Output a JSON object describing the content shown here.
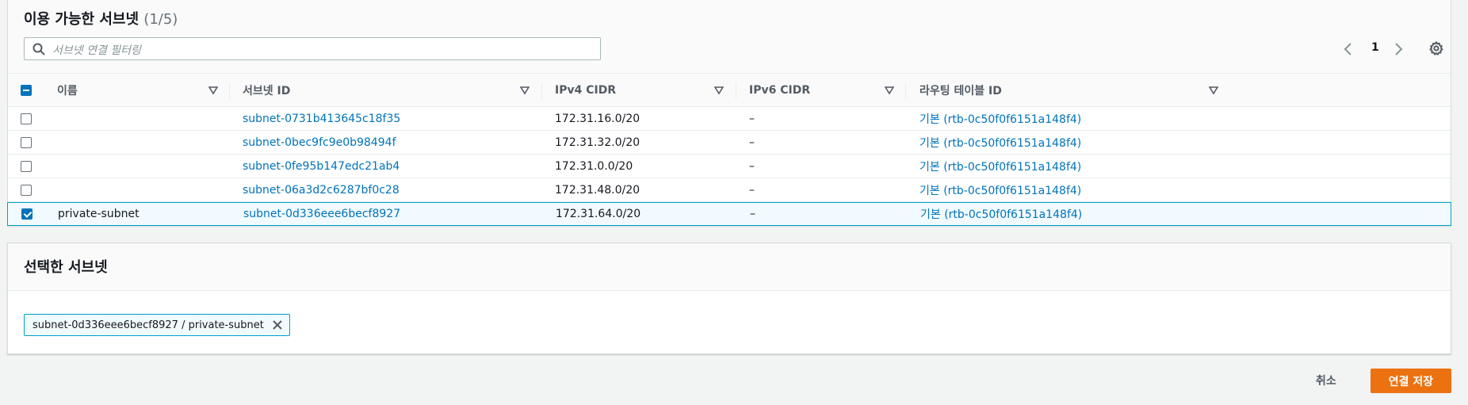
{
  "panel": {
    "title": "이용 가능한 서브넷",
    "count": "(1/5)",
    "filter_placeholder": "서브넷 연결 필터링",
    "page": "1"
  },
  "table": {
    "columns": [
      "이름",
      "서브넷 ID",
      "IPv4 CIDR",
      "IPv6 CIDR",
      "라우팅 테이블 ID"
    ],
    "rows": [
      {
        "name": "",
        "subnet_id": "subnet-0731b413645c18f35",
        "ipv4": "172.31.16.0/20",
        "ipv6": "–",
        "route_table": "기본 (rtb-0c50f0f6151a148f4)",
        "checked": false
      },
      {
        "name": "",
        "subnet_id": "subnet-0bec9fc9e0b98494f",
        "ipv4": "172.31.32.0/20",
        "ipv6": "–",
        "route_table": "기본 (rtb-0c50f0f6151a148f4)",
        "checked": false
      },
      {
        "name": "",
        "subnet_id": "subnet-0fe95b147edc21ab4",
        "ipv4": "172.31.0.0/20",
        "ipv6": "–",
        "route_table": "기본 (rtb-0c50f0f6151a148f4)",
        "checked": false
      },
      {
        "name": "",
        "subnet_id": "subnet-06a3d2c6287bf0c28",
        "ipv4": "172.31.48.0/20",
        "ipv6": "–",
        "route_table": "기본 (rtb-0c50f0f6151a148f4)",
        "checked": false
      },
      {
        "name": "private-subnet",
        "subnet_id": "subnet-0d336eee6becf8927",
        "ipv4": "172.31.64.0/20",
        "ipv6": "–",
        "route_table": "기본 (rtb-0c50f0f6151a148f4)",
        "checked": true
      }
    ]
  },
  "selected": {
    "title": "선택한 서브넷",
    "token": "subnet-0d336eee6becf8927 / private-subnet"
  },
  "actions": {
    "cancel": "취소",
    "save": "연결 저장"
  },
  "colors": {
    "link": "#0073bb",
    "primary_button": "#ec7211",
    "selection_border": "#00a1c9"
  },
  "icons": {
    "search": "search-icon",
    "prev": "chevron-left-icon",
    "next": "chevron-right-icon",
    "settings": "gear-icon",
    "sort": "sort-down-icon",
    "remove": "close-icon"
  }
}
